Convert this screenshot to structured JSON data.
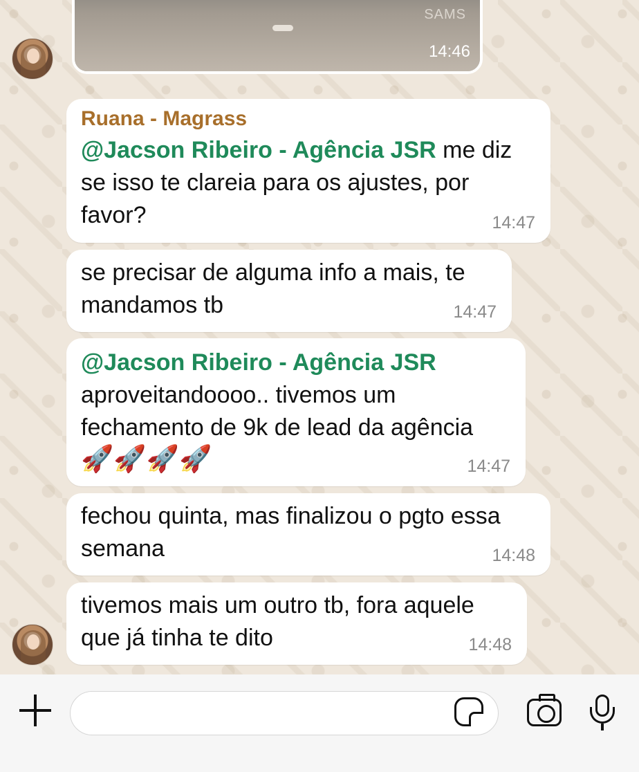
{
  "conversation": {
    "image_message": {
      "brand_text": "SAMS",
      "time": "14:46"
    },
    "messages": [
      {
        "sender": "Ruana - Magrass",
        "line1_mention": "@Jacson Ribeiro - Agência JSR",
        "line1_rest": " me diz",
        "line2": "se isso te clareia para os ajustes, por",
        "line3": "favor?",
        "time": "14:47"
      },
      {
        "line1": "se precisar de alguma info a mais, te",
        "line2": "mandamos tb",
        "time": "14:47"
      },
      {
        "line1_mention": "@Jacson Ribeiro - Agência JSR",
        "line2": "aproveitandoooo.. tivemos um",
        "line3": "fechamento de 9k de lead da agência",
        "line4": "🚀🚀🚀🚀",
        "time": "14:47"
      },
      {
        "line1": "fechou quinta, mas finalizou o pgto essa",
        "line2": "semana",
        "time": "14:48"
      },
      {
        "line1": "tivemos mais um outro tb, fora aquele",
        "line2": "que já tinha te dito",
        "time": "14:48"
      }
    ]
  },
  "composer": {
    "icons": [
      "plus-icon",
      "sticker-icon",
      "camera-icon",
      "microphone-icon"
    ],
    "input_value": ""
  },
  "colors": {
    "mention": "#1f8a5a",
    "sender": "#a86f2b",
    "wallpaper": "#efe7dc"
  }
}
